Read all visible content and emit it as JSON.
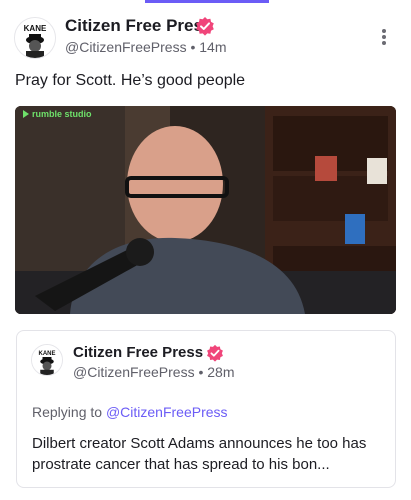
{
  "post": {
    "author_name": "Citizen Free Press",
    "handle": "@CitizenFreePress",
    "separator": "•",
    "time": "14m",
    "text": "Pray for Scott. He’s good people",
    "avatar_logo_text": "KANE"
  },
  "media": {
    "source_label": "rumble studio"
  },
  "quoted_post": {
    "author_name": "Citizen Free Press",
    "handle": "@CitizenFreePress",
    "separator": "•",
    "time": "28m",
    "reply_prefix": "Replying to",
    "reply_to": "@CitizenFreePress",
    "text": "Dilbert creator Scott Adams announces he too has prostrate cancer that has spread to his bon..."
  },
  "colors": {
    "accent": "#6b5cf6",
    "verified_badge": "#f0457a"
  }
}
